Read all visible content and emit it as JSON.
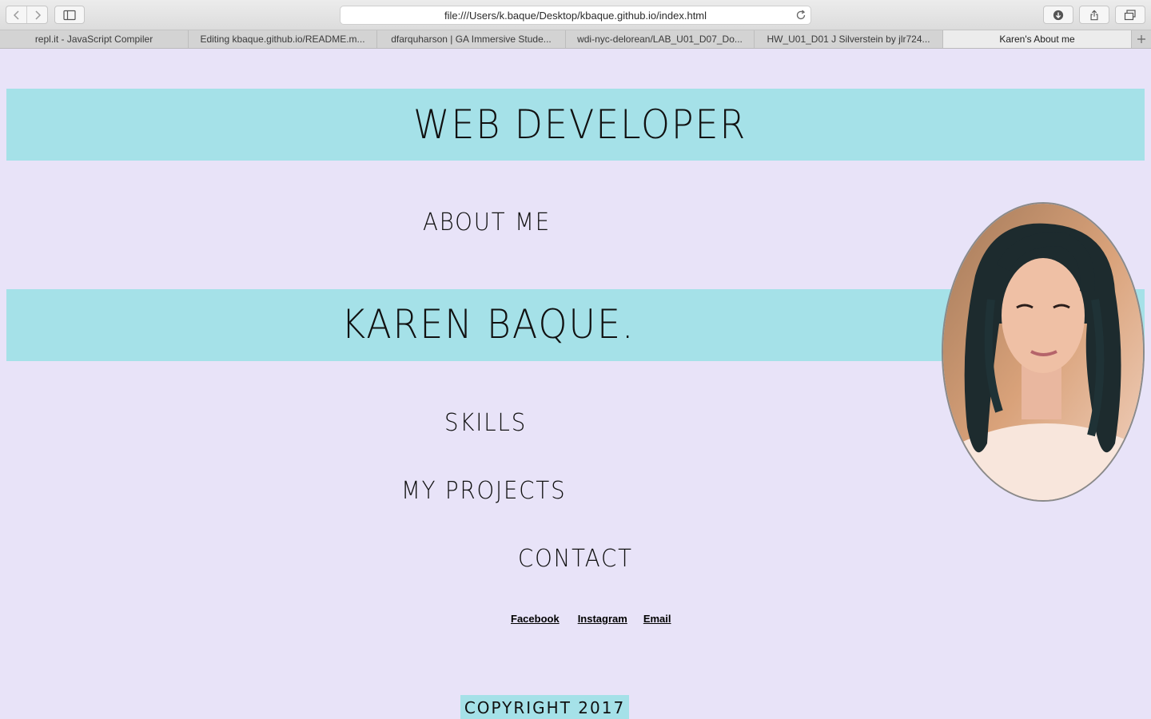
{
  "browser": {
    "url": "file:///Users/k.baque/Desktop/kbaque.github.io/index.html",
    "tabs": [
      {
        "label": "repl.it - JavaScript Compiler"
      },
      {
        "label": "Editing kbaque.github.io/README.m..."
      },
      {
        "label": "dfarquharson | GA Immersive Stude..."
      },
      {
        "label": "wdi-nyc-delorean/LAB_U01_D07_Do..."
      },
      {
        "label": "HW_U01_D01 J Silverstein by jlr724..."
      },
      {
        "label": "Karen's About me"
      }
    ]
  },
  "page": {
    "banner_title": "WEB DEVELOPER",
    "nav": {
      "about": "ABOUT ME",
      "skills": "SKILLS",
      "projects": "MY PROJECTS",
      "contact": "CONTACT"
    },
    "name": "KAREN BAQUE.",
    "social": {
      "facebook": "Facebook",
      "instagram": "Instagram",
      "email": "Email"
    },
    "copyright": "COPYRIGHT 2017"
  },
  "colors": {
    "page_background": "#e8e3f8",
    "band": "#a5e1e8",
    "text": "#111111"
  }
}
